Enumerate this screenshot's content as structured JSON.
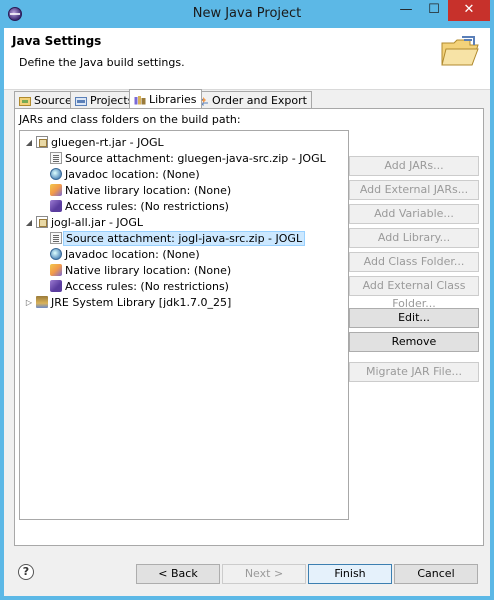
{
  "window": {
    "title": "New Java Project",
    "minimize": "—",
    "maximize": "☐",
    "close": "✕"
  },
  "header": {
    "title": "Java Settings",
    "description": "Define the Java build settings."
  },
  "tabs": [
    {
      "label": "Source",
      "icon": "source-folder-icon"
    },
    {
      "label": "Projects",
      "icon": "projects-icon"
    },
    {
      "label": "Libraries",
      "icon": "libraries-icon",
      "active": true
    },
    {
      "label": "Order and Export",
      "icon": "order-export-icon"
    }
  ],
  "panel": {
    "label": "JARs and class folders on the build path:"
  },
  "tree": [
    {
      "text": "gluegen-rt.jar - JOGL",
      "level": 0,
      "expanded": true,
      "icon": "jar-icon"
    },
    {
      "text": "Source attachment: gluegen-java-src.zip - JOGL",
      "level": 1,
      "icon": "source-attachment-icon"
    },
    {
      "text": "Javadoc location: (None)",
      "level": 1,
      "icon": "javadoc-icon"
    },
    {
      "text": "Native library location: (None)",
      "level": 1,
      "icon": "native-library-icon"
    },
    {
      "text": "Access rules: (No restrictions)",
      "level": 1,
      "icon": "access-rules-icon"
    },
    {
      "text": "jogl-all.jar - JOGL",
      "level": 0,
      "expanded": true,
      "icon": "jar-icon"
    },
    {
      "text": "Source attachment: jogl-java-src.zip - JOGL",
      "level": 1,
      "icon": "source-attachment-icon",
      "selected": true
    },
    {
      "text": "Javadoc location: (None)",
      "level": 1,
      "icon": "javadoc-icon"
    },
    {
      "text": "Native library location: (None)",
      "level": 1,
      "icon": "native-library-icon"
    },
    {
      "text": "Access rules: (No restrictions)",
      "level": 1,
      "icon": "access-rules-icon"
    },
    {
      "text": "JRE System Library [jdk1.7.0_25]",
      "level": 0,
      "expanded": false,
      "icon": "jre-library-icon"
    }
  ],
  "side_buttons": [
    {
      "label": "Add JARs...",
      "enabled": false
    },
    {
      "label": "Add External JARs...",
      "enabled": false
    },
    {
      "label": "Add Variable...",
      "enabled": false
    },
    {
      "label": "Add Library...",
      "enabled": false
    },
    {
      "label": "Add Class Folder...",
      "enabled": false
    },
    {
      "label": "Add External Class Folder...",
      "enabled": false
    },
    {
      "label": "Edit...",
      "enabled": true
    },
    {
      "label": "Remove",
      "enabled": true
    },
    {
      "label": "Migrate JAR File...",
      "enabled": false
    }
  ],
  "footer": {
    "help": "?",
    "back": "< Back",
    "next": "Next >",
    "finish": "Finish",
    "cancel": "Cancel"
  }
}
